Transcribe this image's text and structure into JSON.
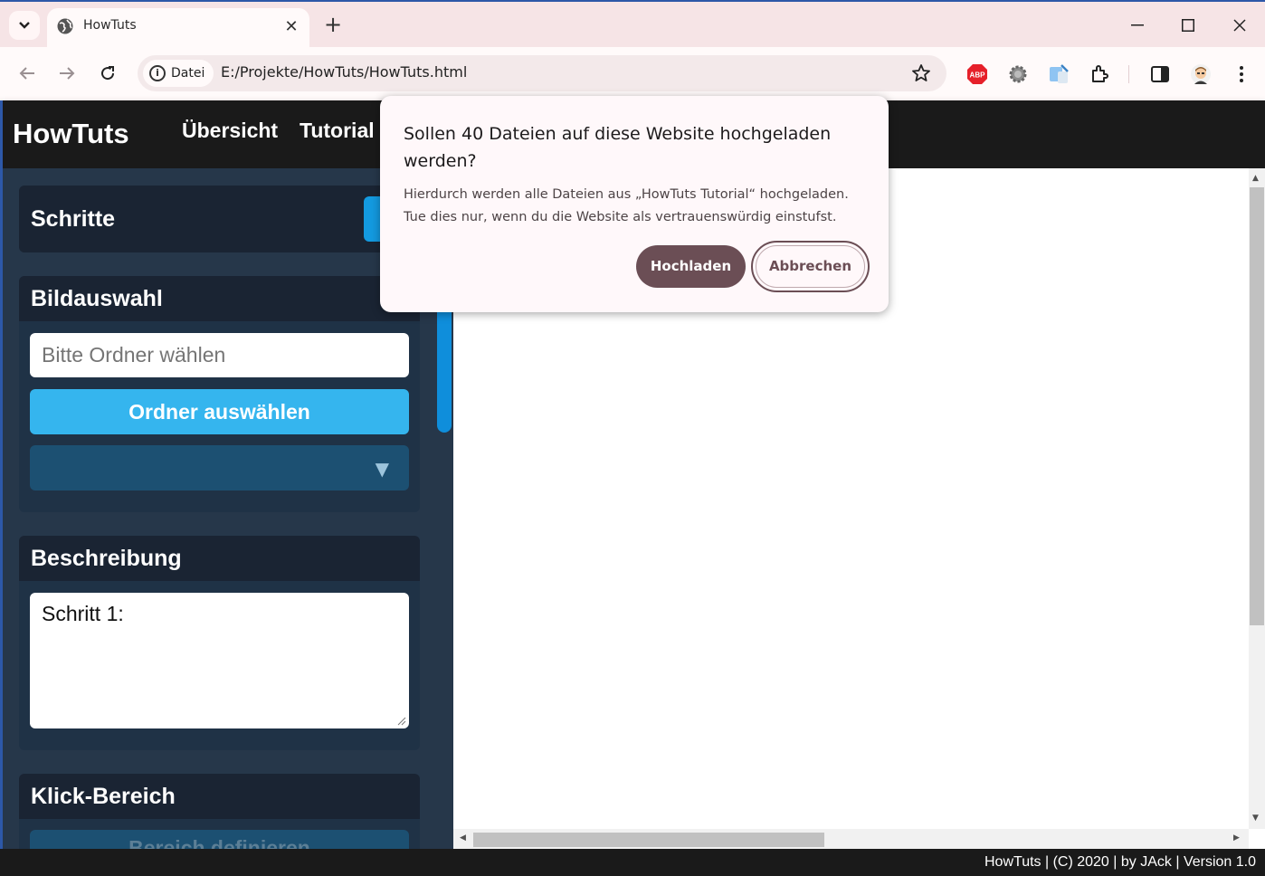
{
  "browser": {
    "tab_title": "HowTuts",
    "new_tab": "+",
    "site_chip": "Datei",
    "url": "E:/Projekte/HowTuts/HowTuts.html",
    "extensions": [
      "adblock-plus-icon",
      "gear-extension-icon",
      "puzzle-edit-icon",
      "extensions-icon"
    ],
    "accent": "#2d58a8"
  },
  "app": {
    "logo": "HowTuts",
    "nav": [
      "Übersicht",
      "Tutorial"
    ],
    "panels": {
      "steps": "Schritte",
      "image_select": "Bildauswahl",
      "folder_placeholder": "Bitte Ordner wählen",
      "folder_button": "Ordner auswählen",
      "description": "Beschreibung",
      "description_value": "Schritt 1:",
      "click_area": "Klick-Bereich",
      "click_area_button": "Bereich definieren"
    },
    "footer": "HowTuts | (C) 2020 | by JAck | Version 1.0"
  },
  "dialog": {
    "title": "Sollen 40 Dateien auf diese Website hochgeladen werden?",
    "body": "Hierdurch werden alle Dateien aus „HowTuts Tutorial“ hochgeladen. Tue dies nur, wenn du die Website als vertrauenswürdig einstufst.",
    "upload": "Hochladen",
    "cancel": "Abbrechen",
    "button_color": "#6b4e55"
  }
}
